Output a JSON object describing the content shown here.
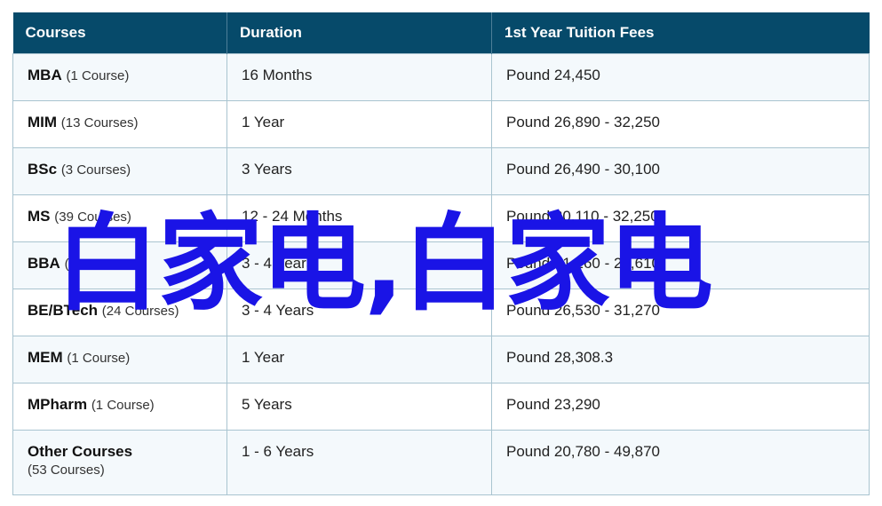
{
  "table": {
    "headers": [
      "Courses",
      "Duration",
      "1st Year Tuition Fees"
    ],
    "rows": [
      {
        "course": "MBA",
        "count": "(1 Course)",
        "duration": "16 Months",
        "fees": "Pound 24,450"
      },
      {
        "course": "MIM",
        "count": "(13 Courses)",
        "duration": "1 Year",
        "fees": "Pound 26,890 - 32,250"
      },
      {
        "course": "BSc",
        "count": "(3 Courses)",
        "duration": "3 Years",
        "fees": "Pound 26,490 - 30,100"
      },
      {
        "course": "MS",
        "count": "(39 Courses)",
        "duration": "12 - 24 Months",
        "fees": "Pound 20,110 - 32,250"
      },
      {
        "course": "BBA",
        "count": "(12 Courses)",
        "duration": "3 - 4 Years",
        "fees": "Pound 21,260 - 28,610"
      },
      {
        "course": "BE/BTech",
        "count": "(24 Courses)",
        "duration": "3 - 4 Years",
        "fees": "Pound 26,530 - 31,270"
      },
      {
        "course": "MEM",
        "count": "(1 Course)",
        "duration": "1 Year",
        "fees": "Pound 28,308.3"
      },
      {
        "course": "MPharm",
        "count": "(1 Course)",
        "duration": "5 Years",
        "fees": "Pound 23,290"
      },
      {
        "course": "Other Courses",
        "count": "(53 Courses)",
        "duration": "1 - 6 Years",
        "fees": "Pound 20,780 - 49,870"
      }
    ]
  },
  "watermark": {
    "text": "白家电,白家电",
    "color": "#1a14e6"
  }
}
